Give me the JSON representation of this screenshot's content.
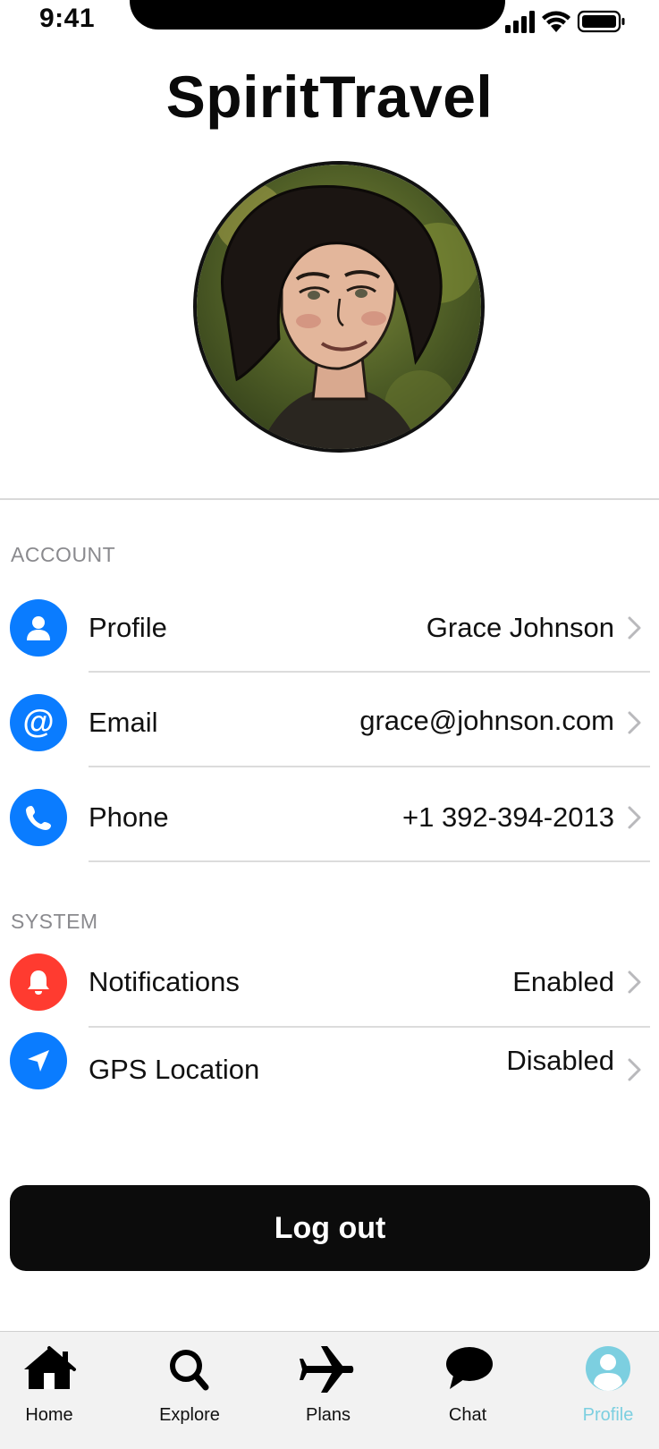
{
  "status_bar": {
    "time": "9:41"
  },
  "app": {
    "title": "SpiritTravel"
  },
  "account": {
    "header": "ACCOUNT",
    "items": [
      {
        "label": "Profile",
        "value": "Grace Johnson",
        "icon": "person-icon"
      },
      {
        "label": "Email",
        "value": "grace@johnson.com",
        "icon": "at-sign-icon"
      },
      {
        "label": "Phone",
        "value": "+1 392-394-2013",
        "icon": "phone-icon"
      }
    ]
  },
  "system": {
    "header": "SYSTEM",
    "items": [
      {
        "label": "Notifications",
        "value": "Enabled",
        "icon": "bell-icon"
      },
      {
        "label": "GPS Location",
        "value": "Disabled",
        "icon": "location-arrow-icon"
      }
    ]
  },
  "logout": {
    "label": "Log out"
  },
  "tab_bar": {
    "active": "Profile",
    "tabs": [
      {
        "label": "Home",
        "icon": "home-icon"
      },
      {
        "label": "Explore",
        "icon": "search-icon"
      },
      {
        "label": "Plans",
        "icon": "airplane-icon"
      },
      {
        "label": "Chat",
        "icon": "chat-bubble-icon"
      },
      {
        "label": "Profile",
        "icon": "profile-icon"
      }
    ]
  },
  "colors": {
    "accent_blue": "#0a7cff",
    "notifications_red": "#ff3b30",
    "active_tab": "#7ccfe0",
    "button_bg": "#0c0c0c"
  }
}
